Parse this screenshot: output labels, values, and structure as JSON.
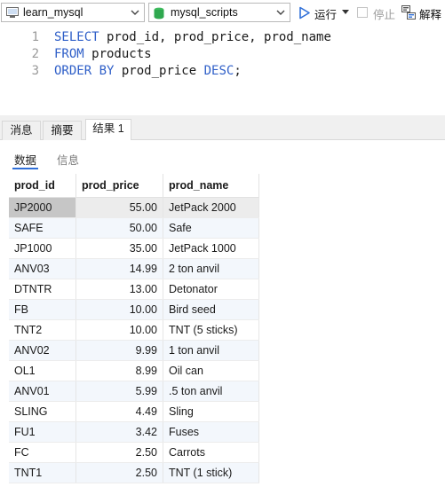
{
  "toolbar": {
    "connection": "learn_mysql",
    "database": "mysql_scripts",
    "run_label": "运行",
    "stop_label": "停止",
    "explain_label": "解释"
  },
  "editor": {
    "line_numbers": [
      "1",
      "2",
      "3"
    ],
    "lines": [
      {
        "kw1": "SELECT",
        "rest1": " prod_id, prod_price, prod_name",
        "kw2": "",
        "rest2": "",
        "kw3": "",
        "rest3": ""
      },
      {
        "kw1": "FROM",
        "rest1": " products",
        "kw2": "",
        "rest2": "",
        "kw3": "",
        "rest3": ""
      },
      {
        "kw1": "ORDER BY",
        "rest1": " prod_price ",
        "kw2": "DESC",
        "rest2": ";",
        "kw3": "",
        "rest3": ""
      }
    ]
  },
  "tabs": {
    "messages": "消息",
    "summary": "摘要",
    "result": "结果 1"
  },
  "subtabs": {
    "data": "数据",
    "info": "信息"
  },
  "grid": {
    "columns": [
      "prod_id",
      "prod_price",
      "prod_name"
    ],
    "rows": [
      [
        "JP2000",
        "55.00",
        "JetPack 2000"
      ],
      [
        "SAFE",
        "50.00",
        "Safe"
      ],
      [
        "JP1000",
        "35.00",
        "JetPack 1000"
      ],
      [
        "ANV03",
        "14.99",
        "2 ton anvil"
      ],
      [
        "DTNTR",
        "13.00",
        "Detonator"
      ],
      [
        "FB",
        "10.00",
        "Bird seed"
      ],
      [
        "TNT2",
        "10.00",
        "TNT (5 sticks)"
      ],
      [
        "ANV02",
        "9.99",
        "1 ton anvil"
      ],
      [
        "OL1",
        "8.99",
        "Oil can"
      ],
      [
        "ANV01",
        "5.99",
        ".5 ton anvil"
      ],
      [
        "SLING",
        "4.49",
        "Sling"
      ],
      [
        "FU1",
        "3.42",
        "Fuses"
      ],
      [
        "FC",
        "2.50",
        "Carrots"
      ],
      [
        "TNT1",
        "2.50",
        "TNT (1 stick)"
      ]
    ]
  },
  "colors": {
    "keyword": "#2f5fc8",
    "accent": "#2f6fd8",
    "db_icon": "#2fa84f"
  },
  "icons": {
    "connection": "connection-icon",
    "database": "database-icon",
    "run": "play-icon",
    "stop": "stop-icon",
    "explain": "explain-icon"
  }
}
